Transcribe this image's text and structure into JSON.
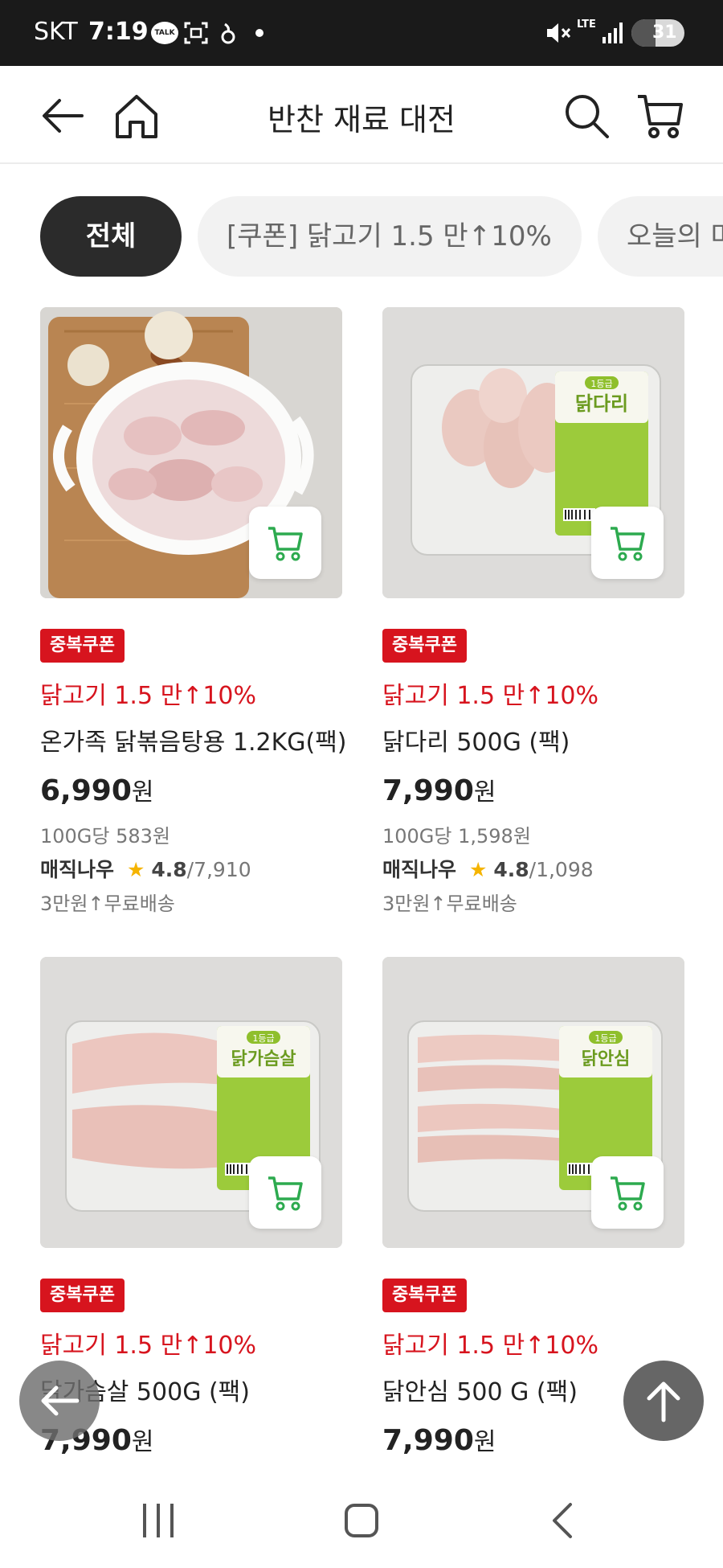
{
  "status_bar": {
    "carrier": "SKT",
    "time": "7:19",
    "talk_badge": "TALK",
    "network": "LTE",
    "battery": "31"
  },
  "header": {
    "title": "반찬 재료 대전"
  },
  "chips": [
    {
      "label": "전체",
      "active": true
    },
    {
      "label": "[쿠폰] 닭고기 1.5 만↑10%",
      "active": false
    },
    {
      "label": "오늘의 마",
      "active": false
    }
  ],
  "products": [
    {
      "badge": "중복쿠폰",
      "promo": "닭고기 1.5 만↑10%",
      "name": "온가족 닭볶음탕용 1.2KG(팩)",
      "price": "6,990",
      "currency": "원",
      "unit_price": "100G당 583원",
      "seller": "매직나우",
      "rating": "4.8",
      "reviews": "/7,910",
      "shipping": "3만원↑무료배송",
      "image_label": ""
    },
    {
      "badge": "중복쿠폰",
      "promo": "닭고기 1.5 만↑10%",
      "name": "닭다리 500G (팩)",
      "price": "7,990",
      "currency": "원",
      "unit_price": "100G당 1,598원",
      "seller": "매직나우",
      "rating": "4.8",
      "reviews": "/1,098",
      "shipping": "3만원↑무료배송",
      "image_label": "닭다리"
    },
    {
      "badge": "중복쿠폰",
      "promo": "닭고기 1.5 만↑10%",
      "name": "닭가슴살 500G (팩)",
      "price": "7,990",
      "currency": "원",
      "image_label": "닭가슴살"
    },
    {
      "badge": "중복쿠폰",
      "promo": "닭고기 1.5 만↑10%",
      "name": "닭안심 500 G (팩)",
      "price": "7,990",
      "currency": "원",
      "image_label": "닭안심"
    }
  ],
  "package_grade": "1등급",
  "colors": {
    "accent_red": "#d7141e",
    "cart_green": "#2daa4f",
    "package_green": "#9ccb3b",
    "chip_active": "#2b2b2b",
    "star": "#f5b400"
  }
}
